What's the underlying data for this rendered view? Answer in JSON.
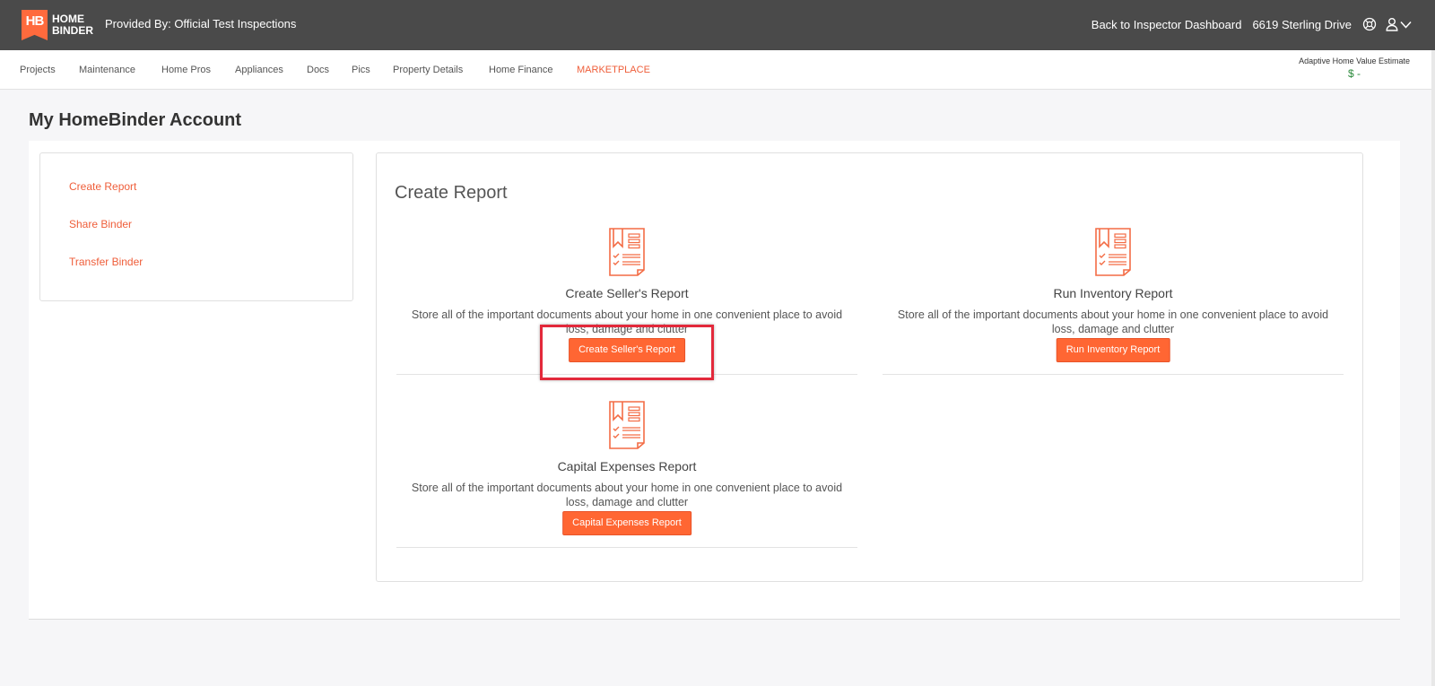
{
  "brand": {
    "logo_mark": "HB",
    "logo_line1": "HOME",
    "logo_line2": "BINDER",
    "provided_by": "Provided By: Official Test Inspections"
  },
  "top_right": {
    "back_link": "Back to Inspector Dashboard",
    "address": "6619 Sterling Drive",
    "icons": [
      "help-icon",
      "user-icon",
      "caret-down-icon"
    ]
  },
  "nav": {
    "items": [
      "Projects",
      "Maintenance",
      "Home Pros",
      "Appliances",
      "Docs",
      "Pics",
      "Property Details",
      "Home Finance",
      "MARKETPLACE"
    ],
    "highlight_color": "#ef5e3a"
  },
  "home_value": {
    "label": "Adaptive Home Value Estimate",
    "value": "$ -"
  },
  "page": {
    "title": "My HomeBinder Account"
  },
  "sidebar": {
    "items": [
      "Create Report",
      "Share Binder",
      "Transfer Binder"
    ]
  },
  "panel": {
    "title": "Create Report",
    "cards": [
      {
        "title": "Create Seller's Report",
        "description": "Store all of the important documents about your home in one convenient place to avoid loss, damage and clutter",
        "button": "Create Seller's Report",
        "highlighted": true
      },
      {
        "title": "Run Inventory Report",
        "description": "Store all of the important documents about your home in one convenient place to avoid loss, damage and clutter",
        "button": "Run Inventory Report",
        "highlighted": false
      },
      {
        "title": "Capital Expenses Report",
        "description": "Store all of the important documents about your home in one convenient place to avoid loss, damage and clutter",
        "button": "Capital Expenses Report",
        "highlighted": false
      }
    ]
  },
  "colors": {
    "accent": "#ff6633",
    "topbar": "#4a4a4a",
    "highlight_box": "#e3293b",
    "value_green": "#2c8a3c"
  }
}
